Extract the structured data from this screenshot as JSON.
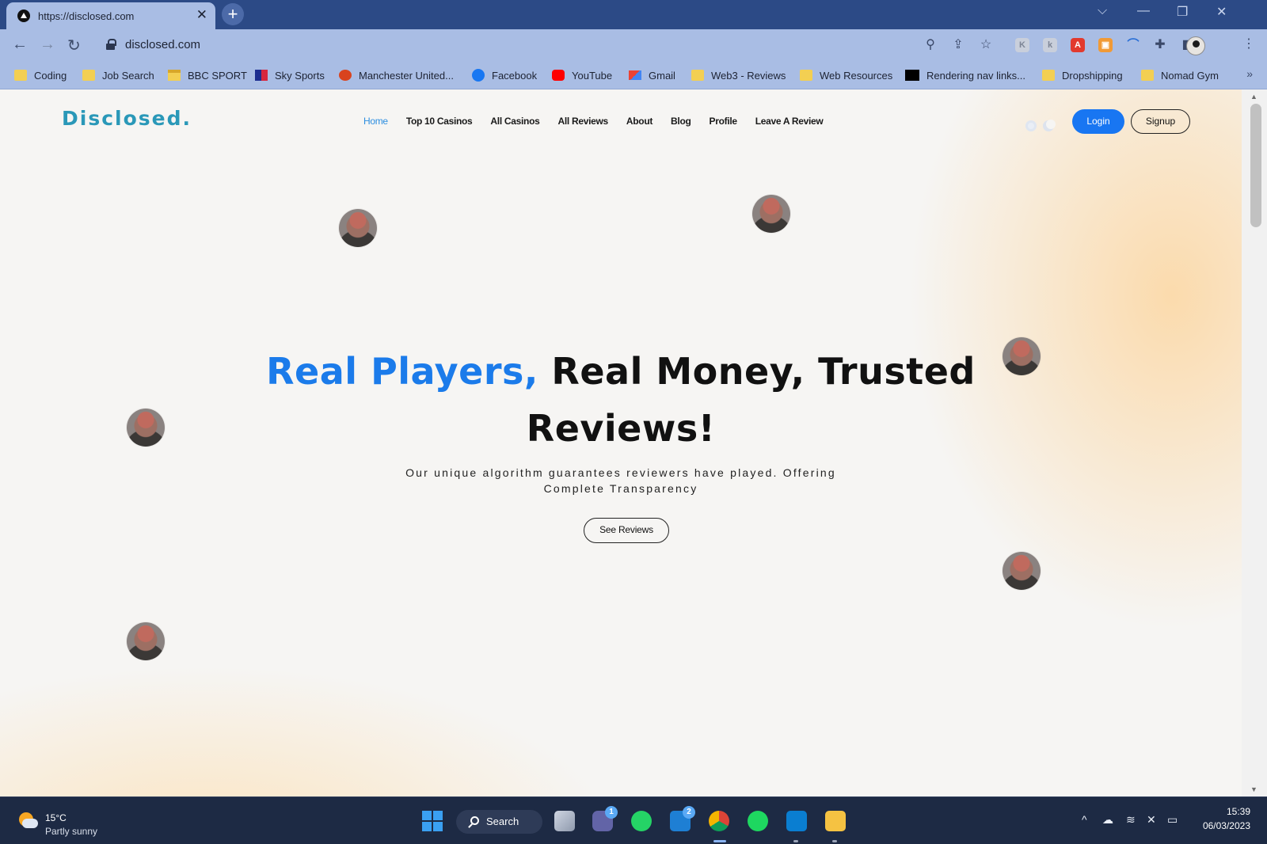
{
  "browser": {
    "tab_title": "https://disclosed.com",
    "address": "disclosed.com",
    "bookmarks": [
      {
        "label": "Coding",
        "icon": "folder-icon"
      },
      {
        "label": "Job Search",
        "icon": "folder-icon"
      },
      {
        "label": "BBC SPORT",
        "icon": "bbc-sport-icon"
      },
      {
        "label": "Sky Sports",
        "icon": "sky-sports-icon"
      },
      {
        "label": "Manchester United...",
        "icon": "man-united-icon"
      },
      {
        "label": "Facebook",
        "icon": "facebook-icon"
      },
      {
        "label": "YouTube",
        "icon": "youtube-icon"
      },
      {
        "label": "Gmail",
        "icon": "gmail-icon"
      },
      {
        "label": "Web3 - Reviews",
        "icon": "folder-icon"
      },
      {
        "label": "Web Resources",
        "icon": "folder-icon"
      },
      {
        "label": "Rendering nav links...",
        "icon": "dev-icon"
      },
      {
        "label": "Dropshipping",
        "icon": "folder-icon"
      },
      {
        "label": "Nomad Gym",
        "icon": "folder-icon"
      }
    ],
    "more_bookmarks": "»"
  },
  "site": {
    "logo": "Disclosed",
    "logo_dot": ".",
    "nav": [
      "Home",
      "Top 10 Casinos",
      "All Casinos",
      "All Reviews",
      "About",
      "Blog",
      "Profile",
      "Leave A Review"
    ],
    "active_nav": "Home",
    "login_label": "Login",
    "signup_label": "Signup",
    "hero": {
      "title_accent": "Real Players,",
      "title_rest": "Real Money, Trusted",
      "title_line2": "Reviews!",
      "subtitle": "Our unique algorithm guarantees reviewers have played. Offering Complete Transparency",
      "cta_label": "See Reviews"
    },
    "colors": {
      "accent": "#1b7bea",
      "logo": "#2a98b8",
      "login_bg": "#1876f2"
    }
  },
  "taskbar": {
    "temperature": "15°C",
    "weather": "Partly sunny",
    "search_label": "Search",
    "teams_badge": "1",
    "mail_badge": "2",
    "time": "15:39",
    "date": "06/03/2023"
  }
}
